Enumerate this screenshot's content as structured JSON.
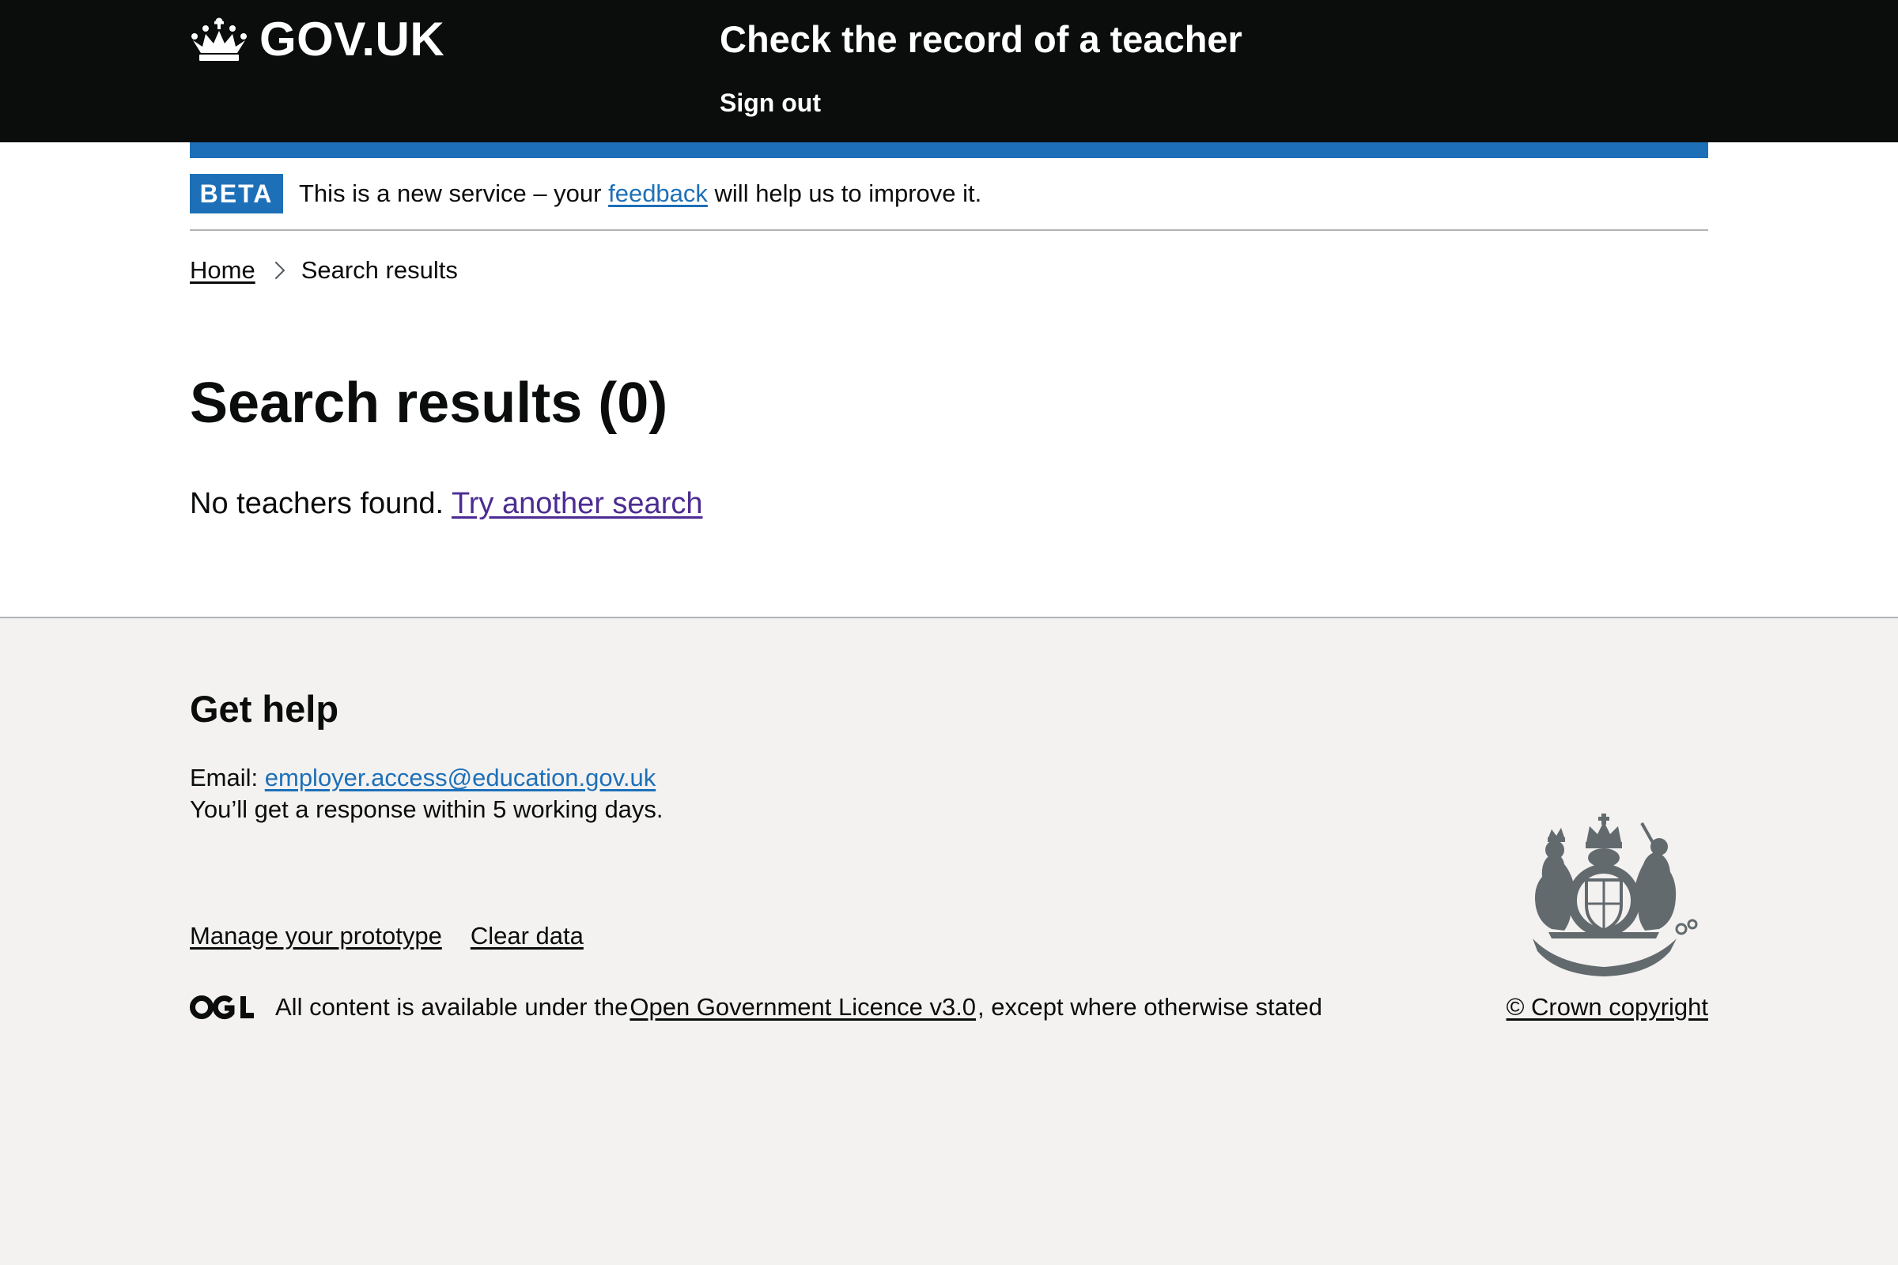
{
  "header": {
    "logo_text": "GOV.UK",
    "service_name": "Check the record of a teacher",
    "sign_out_label": "Sign out"
  },
  "phase_banner": {
    "tag": "BETA",
    "text_before": "This is a new service – your ",
    "link_text": "feedback",
    "text_after": " will help us to improve it."
  },
  "breadcrumbs": {
    "home_label": "Home",
    "current_label": "Search results"
  },
  "main": {
    "title": "Search results (0)",
    "no_results_text": "No teachers found. ",
    "try_again_link": "Try another search"
  },
  "footer": {
    "help_heading": "Get help",
    "email_label": "Email: ",
    "email_address": "employer.access@education.gov.uk",
    "response_text": "You’ll get a response within 5 working days.",
    "links": {
      "manage_prototype": "Manage your prototype",
      "clear_data": "Clear data"
    },
    "licence_before": "All content is available under the ",
    "licence_link": "Open Government Licence v3.0",
    "licence_after": ", except where otherwise stated",
    "crown_copyright": "© Crown copyright"
  },
  "colors": {
    "header_bg": "#0b0c0c",
    "brand_blue": "#1d70b8",
    "visited_link": "#4c2c92",
    "footer_bg": "#f3f2f1",
    "border_grey": "#b1b4b6",
    "crest_grey": "#626a6e"
  },
  "icons": {
    "logo": "crown-icon",
    "breadcrumb_separator": "chevron-right-icon",
    "licence": "ogl-logo",
    "crest": "royal-coat-of-arms"
  }
}
